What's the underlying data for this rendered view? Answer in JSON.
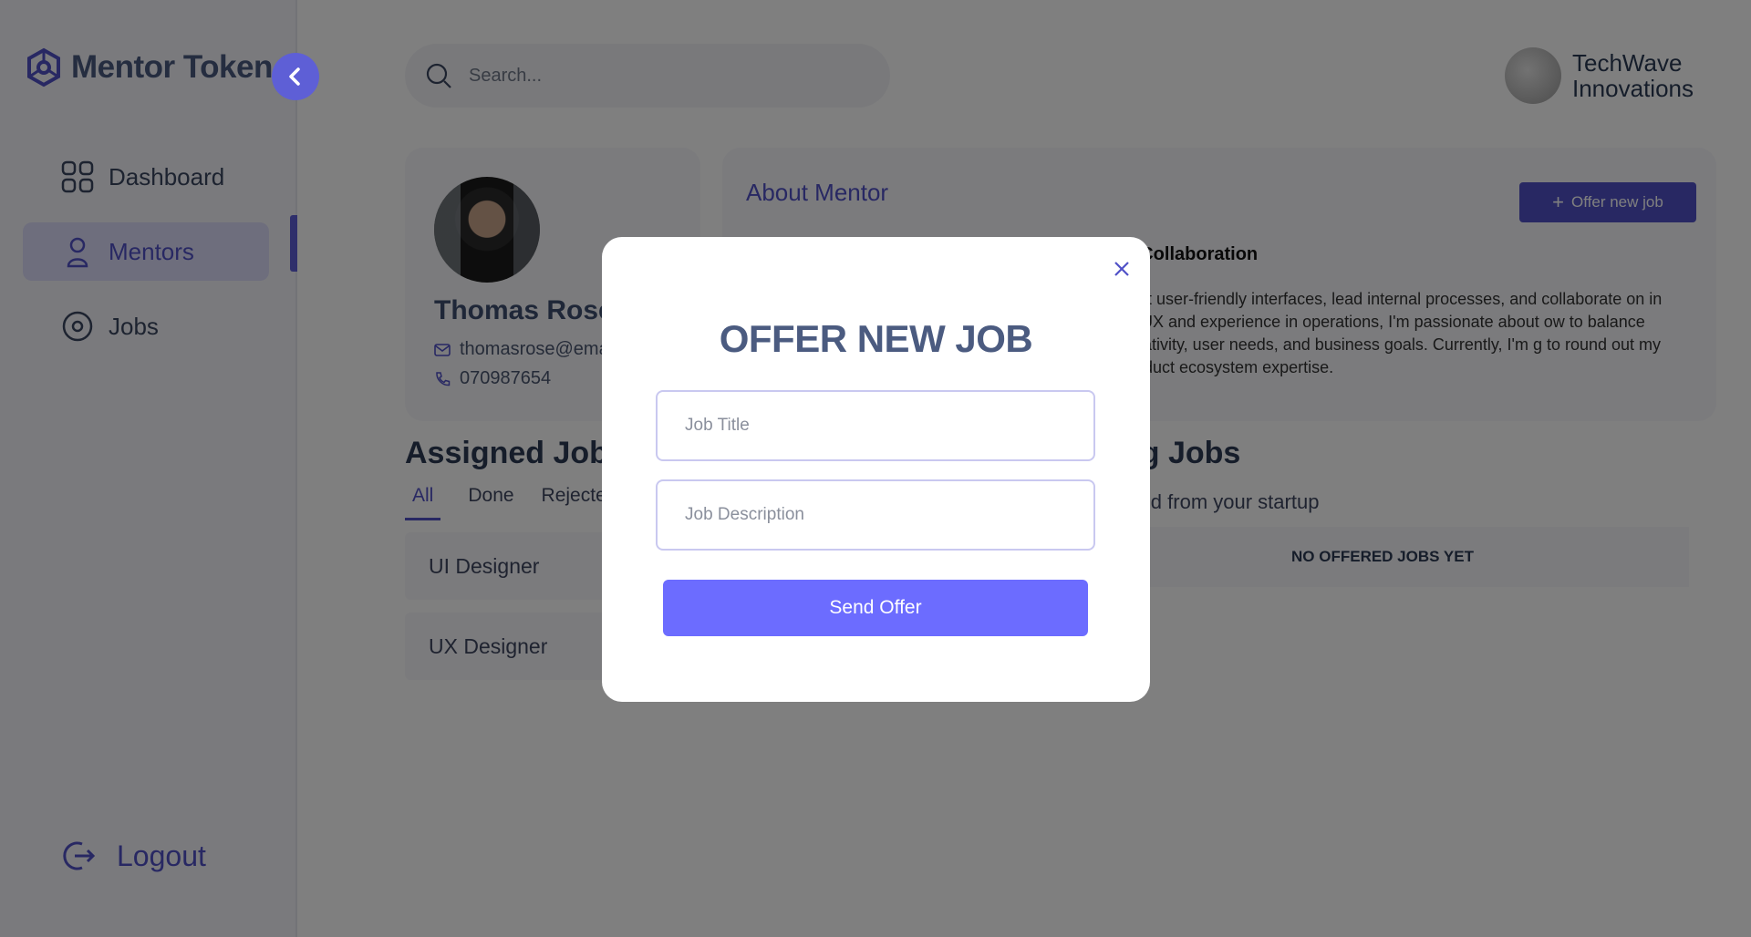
{
  "app": {
    "brand": "Mentor Token"
  },
  "sidebar": {
    "items": [
      {
        "label": "Dashboard",
        "icon": "grid-icon"
      },
      {
        "label": "Mentors",
        "icon": "user-icon",
        "active": true
      },
      {
        "label": "Jobs",
        "icon": "target-icon"
      }
    ],
    "logout_label": "Logout"
  },
  "header": {
    "search_placeholder": "Search...",
    "company_line1": "TechWave",
    "company_line2": "Innovations"
  },
  "profile": {
    "name": "Thomas Rose",
    "email": "thomasrose@email.com",
    "phone": "070987654"
  },
  "about": {
    "title": "About Mentor",
    "offer_button_label": "Offer new job",
    "subtitle": "al Collaboration",
    "text": "craft user-friendly interfaces, lead internal processes, and collaborate on in UI/UX and experience in operations, I'm passionate about ow to balance creativity, user needs, and business goals. Currently, I'm g to round out my product ecosystem expertise."
  },
  "assigned": {
    "title": "Assigned Jobs",
    "tabs": [
      "All",
      "Done",
      "Rejected"
    ],
    "jobs": [
      "UI Designer",
      "UX Designer"
    ]
  },
  "pending": {
    "title": "ng Jobs",
    "subtitle": "ered from your startup",
    "empty_label": "NO OFFERED JOBS YET"
  },
  "modal": {
    "title": "OFFER NEW JOB",
    "job_title_placeholder": "Job Title",
    "job_description_placeholder": "Job Description",
    "send_label": "Send Offer"
  },
  "colors": {
    "accent": "#5051c7",
    "send_button": "#6c6cff",
    "overlay": "rgba(0,0,0,0.5)"
  }
}
